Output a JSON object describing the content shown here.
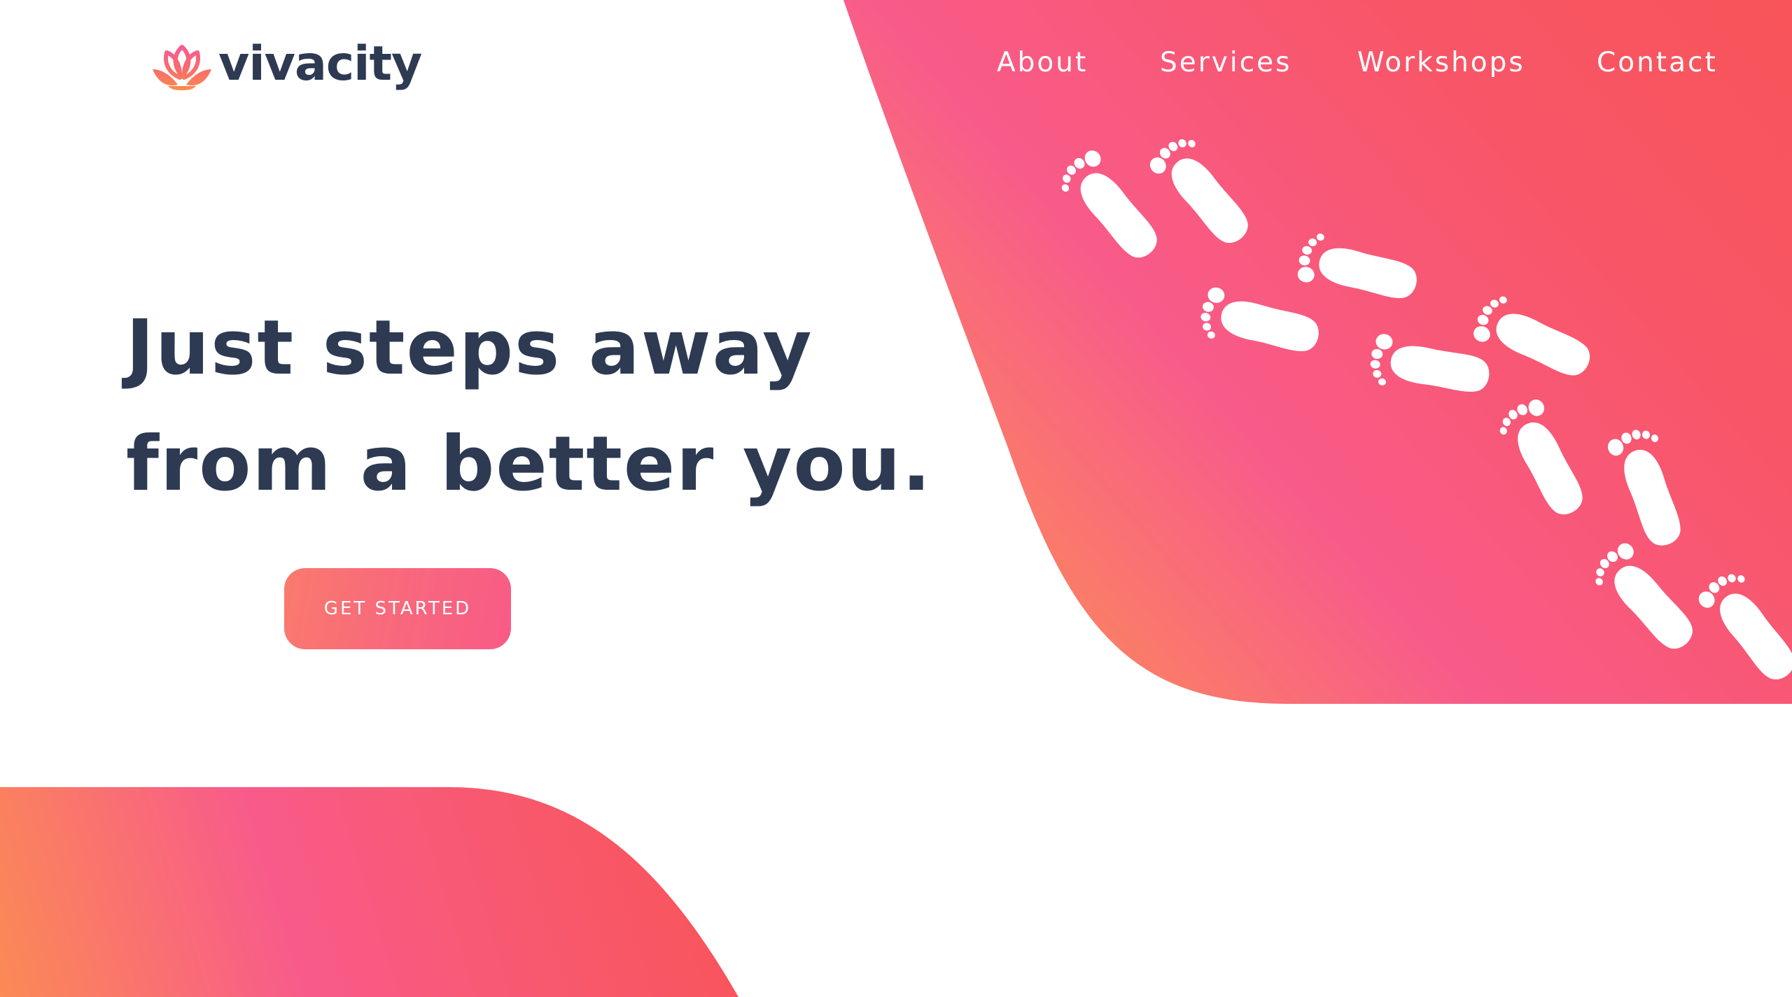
{
  "brand": {
    "name": "vivacity",
    "logo_icon": "lotus-icon",
    "text_color": "#2d3a52"
  },
  "nav": {
    "items": [
      {
        "label": "About"
      },
      {
        "label": "Services"
      },
      {
        "label": "Workshops"
      },
      {
        "label": "Contact"
      }
    ]
  },
  "hero": {
    "title_line1": "Just steps away",
    "title_line2": "from a better you.",
    "cta_label": "GET STARTED",
    "decoration_icon": "footprints-icon"
  },
  "colors": {
    "gradient_orange": "#fb8a5a",
    "gradient_pink": "#f85b8a",
    "gradient_red": "#f8545c",
    "heading": "#2d3a52"
  }
}
